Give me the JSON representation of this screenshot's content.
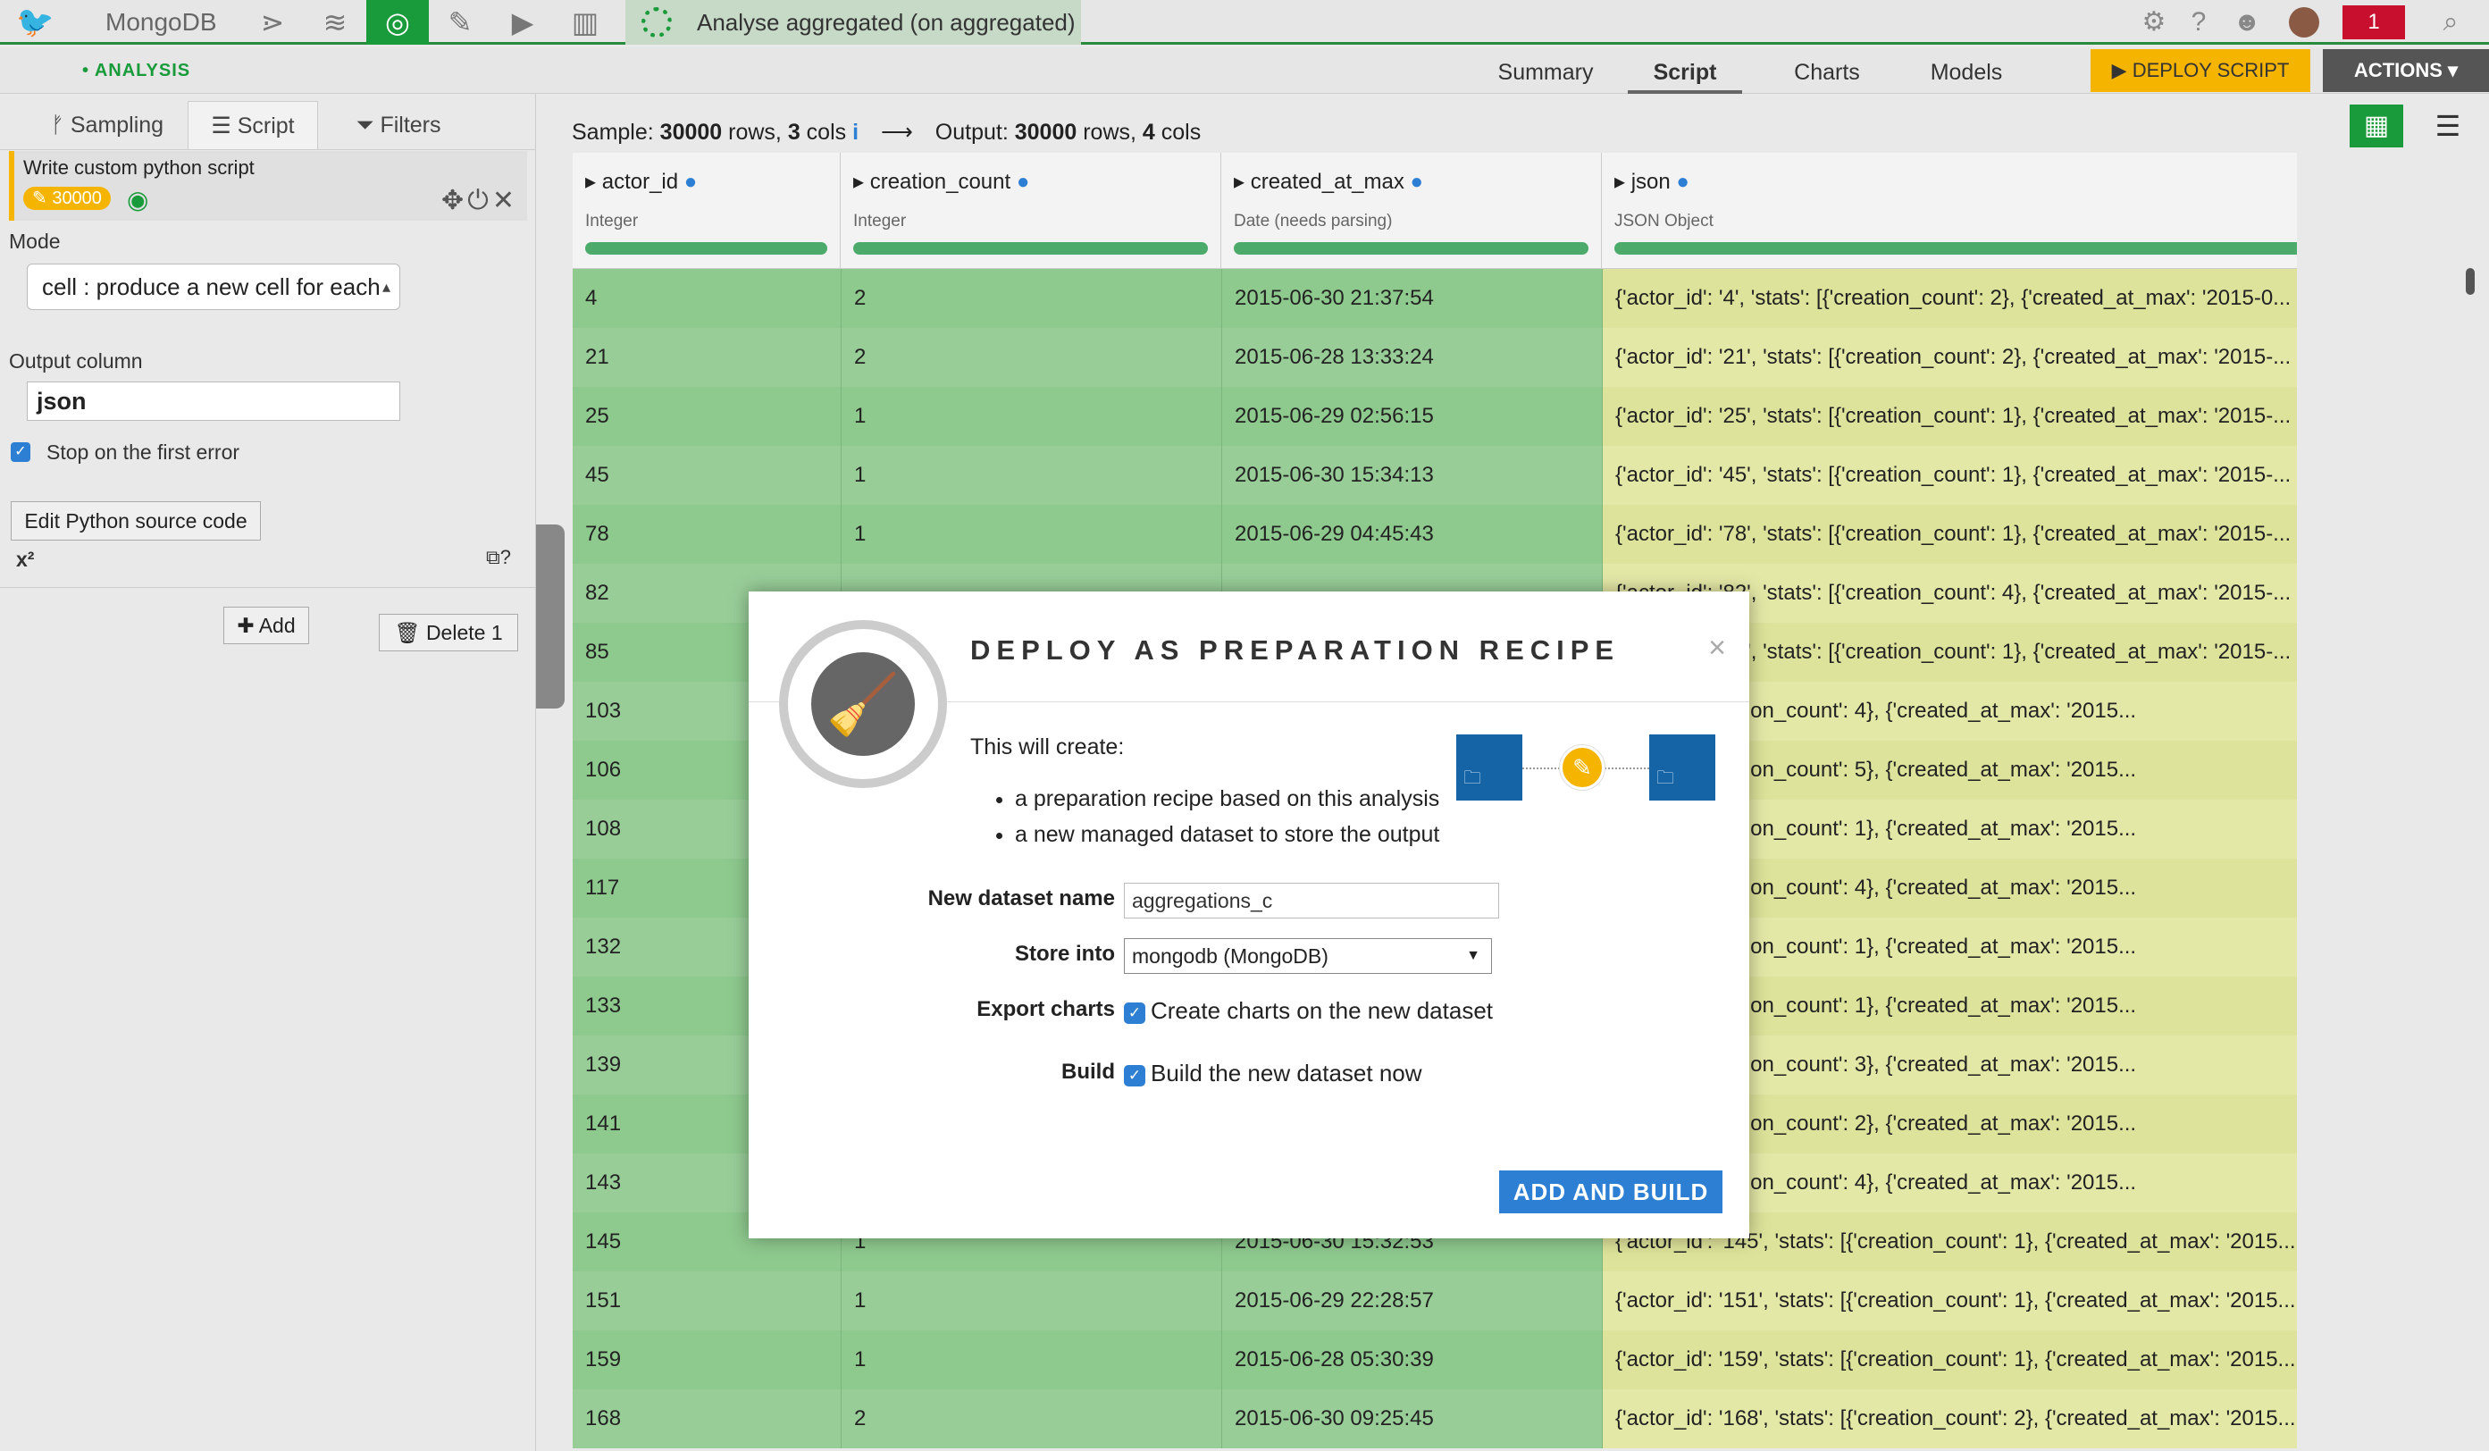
{
  "topnav": {
    "project": "MongoDB",
    "breadcrumb": "Analyse aggregated (on aggregated)",
    "notifications": "1"
  },
  "subnav": {
    "section": "• ANALYSIS",
    "tabs": [
      "Summary",
      "Script",
      "Charts",
      "Models"
    ],
    "active_tab": "Script",
    "deploy_label": "▶ DEPLOY SCRIPT",
    "actions_label": "ACTIONS ▾"
  },
  "left": {
    "tabs": [
      "Sampling",
      "Script",
      "Filters"
    ],
    "step_title": "Write custom python script",
    "step_badge": "✎ 30000",
    "mode_label": "Mode",
    "mode_value": "cell : produce a new cell for each",
    "output_label": "Output column",
    "output_value": "json",
    "stop_label": "Stop on the first error",
    "edit_btn": "Edit Python source code",
    "formula_label": "x²",
    "add_btn": "✚ Add",
    "delete_btn": "🗑 Delete 1"
  },
  "main": {
    "sample_prefix": "Sample: ",
    "sample_rows": "30000",
    "sample_rows_suffix": " rows, ",
    "sample_cols": "3",
    "sample_cols_suffix": " cols",
    "output_prefix": "Output: ",
    "output_rows": "30000",
    "output_rows_suffix": " rows, ",
    "output_cols": "4",
    "output_cols_suffix": " cols"
  },
  "columns": [
    {
      "name": "actor_id",
      "type": "Integer"
    },
    {
      "name": "creation_count",
      "type": "Integer"
    },
    {
      "name": "created_at_max",
      "type": "Date (needs parsing)"
    },
    {
      "name": "json",
      "type": "JSON Object"
    }
  ],
  "rows": [
    [
      "4",
      "2",
      "2015-06-30 21:37:54",
      "{'actor_id': '4', 'stats': [{'creation_count': 2}, {'created_at_max': '2015-0..."
    ],
    [
      "21",
      "2",
      "2015-06-28 13:33:24",
      "{'actor_id': '21', 'stats': [{'creation_count': 2}, {'created_at_max': '2015-..."
    ],
    [
      "25",
      "1",
      "2015-06-29 02:56:15",
      "{'actor_id': '25', 'stats': [{'creation_count': 1}, {'created_at_max': '2015-..."
    ],
    [
      "45",
      "1",
      "2015-06-30 15:34:13",
      "{'actor_id': '45', 'stats': [{'creation_count': 1}, {'created_at_max': '2015-..."
    ],
    [
      "78",
      "1",
      "2015-06-29 04:45:43",
      "{'actor_id': '78', 'stats': [{'creation_count': 1}, {'created_at_max': '2015-..."
    ],
    [
      "82",
      "",
      "",
      "{'actor_id': '82', 'stats': [{'creation_count': 4}, {'created_at_max': '2015-..."
    ],
    [
      "85",
      "",
      "",
      "{'actor_id': '85', 'stats': [{'creation_count': 1}, {'created_at_max': '2015-..."
    ],
    [
      "103",
      "",
      "",
      "'stats': [{'creation_count': 4}, {'created_at_max': '2015..."
    ],
    [
      "106",
      "",
      "",
      "'stats': [{'creation_count': 5}, {'created_at_max': '2015..."
    ],
    [
      "108",
      "",
      "",
      "'stats': [{'creation_count': 1}, {'created_at_max': '2015..."
    ],
    [
      "117",
      "",
      "",
      "'stats': [{'creation_count': 4}, {'created_at_max': '2015..."
    ],
    [
      "132",
      "",
      "",
      "'stats': [{'creation_count': 1}, {'created_at_max': '2015..."
    ],
    [
      "133",
      "",
      "",
      "'stats': [{'creation_count': 1}, {'created_at_max': '2015..."
    ],
    [
      "139",
      "",
      "",
      "'stats': [{'creation_count': 3}, {'created_at_max': '2015..."
    ],
    [
      "141",
      "",
      "",
      "'stats': [{'creation_count': 2}, {'created_at_max': '2015..."
    ],
    [
      "143",
      "",
      "",
      "'stats': [{'creation_count': 4}, {'created_at_max': '2015..."
    ],
    [
      "145",
      "1",
      "2015-06-30 15:32:53",
      "{'actor_id': '145', 'stats': [{'creation_count': 1}, {'created_at_max': '2015..."
    ],
    [
      "151",
      "1",
      "2015-06-29 22:28:57",
      "{'actor_id': '151', 'stats': [{'creation_count': 1}, {'created_at_max': '2015..."
    ],
    [
      "159",
      "1",
      "2015-06-28 05:30:39",
      "{'actor_id': '159', 'stats': [{'creation_count': 1}, {'created_at_max': '2015..."
    ],
    [
      "168",
      "2",
      "2015-06-30 09:25:45",
      "{'actor_id': '168', 'stats': [{'creation_count': 2}, {'created_at_max': '2015..."
    ]
  ],
  "modal": {
    "title": "DEPLOY AS PREPARATION RECIPE",
    "intro": "This will create:",
    "bullets": [
      "a preparation recipe based on this analysis",
      "a new managed dataset to store the output"
    ],
    "name_label": "New dataset name",
    "name_value": "aggregations_c",
    "store_label": "Store into",
    "store_value": "mongodb (MongoDB)",
    "export_label": "Export charts",
    "export_text": "Create charts on the new dataset",
    "build_label": "Build",
    "build_text": "Build the new dataset now",
    "primary_label": "ADD AND BUILD"
  },
  "colors": {
    "accent": "#1a9b3b",
    "warning": "#f4b400",
    "primary": "#2d7fd3"
  }
}
